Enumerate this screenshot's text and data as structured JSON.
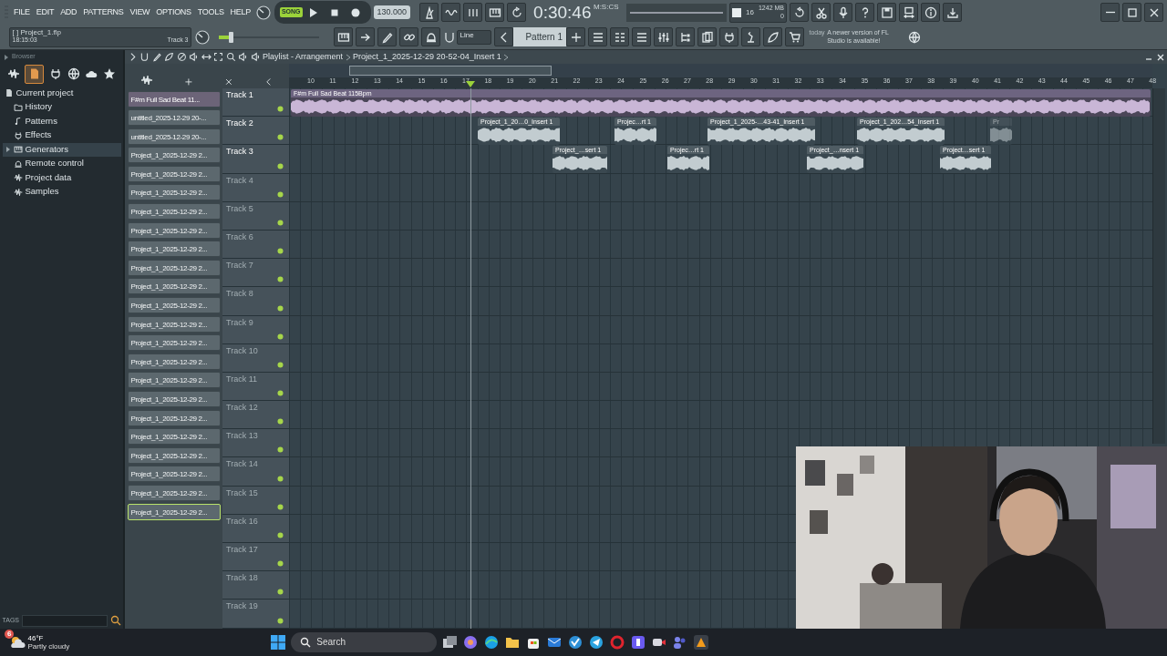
{
  "menu": [
    "FILE",
    "EDIT",
    "ADD",
    "PATTERNS",
    "VIEW",
    "OPTIONS",
    "TOOLS",
    "HELP"
  ],
  "transport": {
    "mode": "SONG",
    "song_selected": true,
    "tempo": "130.000",
    "time": "0:30:46",
    "time_unit": "M:S:CS"
  },
  "monitor": {
    "polyphony": "16",
    "memory": "1242 MB",
    "value": "0"
  },
  "hint": {
    "file": "[ ] Project_1.flp",
    "clock": "18:15:03",
    "track": "Track 3"
  },
  "master": {
    "level": 0.12
  },
  "snap": "Line",
  "pattern": "Pattern 1",
  "news": {
    "date": "today",
    "message": "A newer version of FL Studio is available!"
  },
  "browser": {
    "title": "Browser",
    "tags": "TAGS",
    "tree": [
      {
        "label": "Current project",
        "selected": false,
        "children": [
          {
            "label": "History",
            "selected": false
          },
          {
            "label": "Patterns",
            "selected": false
          },
          {
            "label": "Effects",
            "selected": false
          },
          {
            "label": "Generators",
            "selected": true,
            "expanded": false
          },
          {
            "label": "Remote control",
            "selected": false
          },
          {
            "label": "Project data",
            "selected": false
          },
          {
            "label": "Samples",
            "selected": false
          }
        ]
      }
    ]
  },
  "playlist": {
    "title": "Playlist - Arrangement",
    "path": "Project_1_2025-12-29 20-52-04_Insert 1",
    "patterns": [
      {
        "label": "F#m Full Sad Beat 11...",
        "kind": "sample",
        "selected": false
      },
      {
        "label": "untitled_2025-12-29 20-...",
        "kind": "recording",
        "selected": false
      },
      {
        "label": "untitled_2025-12-29 20-...",
        "kind": "recording",
        "selected": false
      },
      {
        "label": "Project_1_2025-12-29 2...",
        "kind": "recording",
        "selected": false
      },
      {
        "label": "Project_1_2025-12-29 2...",
        "kind": "recording",
        "selected": false
      },
      {
        "label": "Project_1_2025-12-29 2...",
        "kind": "recording",
        "selected": false
      },
      {
        "label": "Project_1_2025-12-29 2...",
        "kind": "recording",
        "selected": false
      },
      {
        "label": "Project_1_2025-12-29 2...",
        "kind": "recording",
        "selected": false
      },
      {
        "label": "Project_1_2025-12-29 2...",
        "kind": "recording",
        "selected": false
      },
      {
        "label": "Project_1_2025-12-29 2...",
        "kind": "recording",
        "selected": false
      },
      {
        "label": "Project_1_2025-12-29 2...",
        "kind": "recording",
        "selected": false
      },
      {
        "label": "Project_1_2025-12-29 2...",
        "kind": "recording",
        "selected": false
      },
      {
        "label": "Project_1_2025-12-29 2...",
        "kind": "recording",
        "selected": false
      },
      {
        "label": "Project_1_2025-12-29 2...",
        "kind": "recording",
        "selected": false
      },
      {
        "label": "Project_1_2025-12-29 2...",
        "kind": "recording",
        "selected": false
      },
      {
        "label": "Project_1_2025-12-29 2...",
        "kind": "recording",
        "selected": false
      },
      {
        "label": "Project_1_2025-12-29 2...",
        "kind": "recording",
        "selected": false
      },
      {
        "label": "Project_1_2025-12-29 2...",
        "kind": "recording",
        "selected": false
      },
      {
        "label": "Project_1_2025-12-29 2...",
        "kind": "recording",
        "selected": false
      },
      {
        "label": "Project_1_2025-12-29 2...",
        "kind": "recording",
        "selected": false
      },
      {
        "label": "Project_1_2025-12-29 2...",
        "kind": "recording",
        "selected": false
      },
      {
        "label": "Project_1_2025-12-29 2...",
        "kind": "recording",
        "selected": false
      },
      {
        "label": "Project_1_2025-12-29 2...",
        "kind": "recording",
        "selected": true
      }
    ],
    "ruler": [
      "10",
      "11",
      "12",
      "13",
      "14",
      "15",
      "16",
      "17",
      "18",
      "19",
      "20",
      "21",
      "22",
      "23",
      "24",
      "25",
      "26",
      "27",
      "28",
      "29",
      "30",
      "31",
      "32",
      "33",
      "34",
      "35",
      "36",
      "37",
      "38",
      "39",
      "40",
      "41",
      "42",
      "43",
      "44",
      "45",
      "46",
      "47",
      "48"
    ],
    "tracks": [
      {
        "name": "Track 1",
        "dimmed": false,
        "muted": false,
        "clips": [
          {
            "label": "F#m Full Sad Beat 115Bpm",
            "kind": "sample",
            "muted": false
          }
        ]
      },
      {
        "name": "Track 2",
        "dimmed": false,
        "muted": false,
        "clips": [
          {
            "label": "Project_1_20…0_Insert 1",
            "kind": "recording",
            "muted": false
          },
          {
            "label": "Projec…rt 1",
            "kind": "recording",
            "muted": false
          },
          {
            "label": "Project_1_2025-…43-41_Insert 1",
            "kind": "recording",
            "muted": false
          },
          {
            "label": "Project_1_202…54_Insert 1",
            "kind": "recording",
            "muted": false
          },
          {
            "label": "Pr",
            "kind": "recording",
            "muted": true
          }
        ]
      },
      {
        "name": "Track 3",
        "dimmed": false,
        "muted": false,
        "clips": [
          {
            "label": "Project_…sert 1",
            "kind": "recording",
            "muted": false
          },
          {
            "label": "Projec…rt 1",
            "kind": "recording",
            "muted": false
          },
          {
            "label": "Project_…nsert 1",
            "kind": "recording",
            "muted": false
          },
          {
            "label": "Project…sert 1",
            "kind": "recording",
            "muted": false
          }
        ]
      },
      {
        "name": "Track 4",
        "dimmed": true,
        "muted": false
      },
      {
        "name": "Track 5",
        "dimmed": true,
        "muted": false
      },
      {
        "name": "Track 6",
        "dimmed": true,
        "muted": false
      },
      {
        "name": "Track 7",
        "dimmed": true,
        "muted": false
      },
      {
        "name": "Track 8",
        "dimmed": true,
        "muted": false
      },
      {
        "name": "Track 9",
        "dimmed": true,
        "muted": false
      },
      {
        "name": "Track 10",
        "dimmed": true,
        "muted": false
      },
      {
        "name": "Track 11",
        "dimmed": true,
        "muted": false
      },
      {
        "name": "Track 12",
        "dimmed": true,
        "muted": false
      },
      {
        "name": "Track 13",
        "dimmed": true,
        "muted": false
      },
      {
        "name": "Track 14",
        "dimmed": true,
        "muted": false
      },
      {
        "name": "Track 15",
        "dimmed": true,
        "muted": false
      },
      {
        "name": "Track 16",
        "dimmed": true,
        "muted": false
      },
      {
        "name": "Track 17",
        "dimmed": true,
        "muted": false
      },
      {
        "name": "Track 18",
        "dimmed": true,
        "muted": false
      },
      {
        "name": "Track 19",
        "dimmed": true,
        "muted": false
      }
    ]
  },
  "taskbar": {
    "temperature": "46°F",
    "weather": "Partly cloudy",
    "badge": "6",
    "search": "Search"
  }
}
